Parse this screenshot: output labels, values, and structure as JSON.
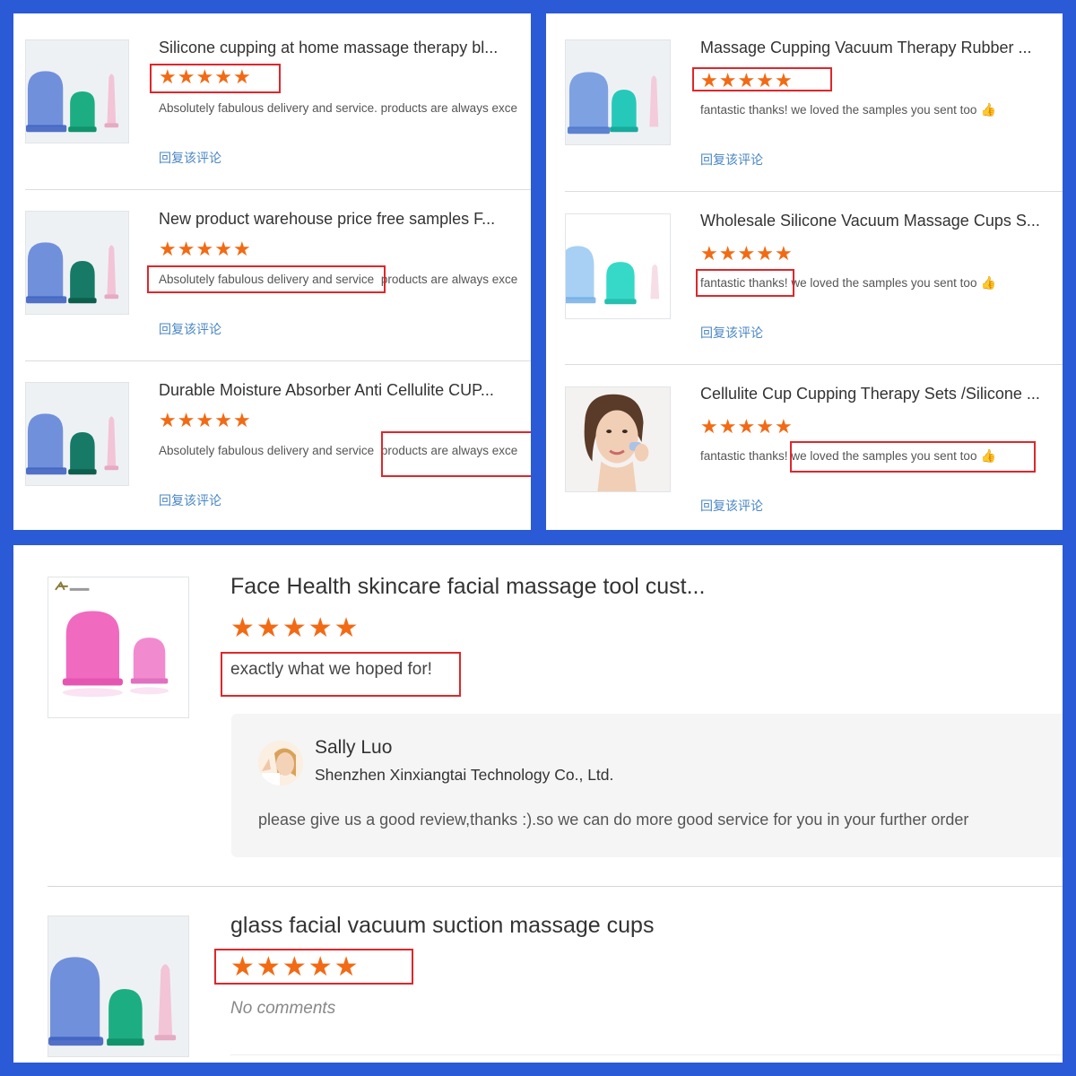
{
  "left_panel": {
    "reviews": [
      {
        "title": "Silicone cupping at home massage therapy bl...",
        "comment": "Absolutely fabulous delivery and service. products are always exce",
        "reply_link": "回复该评论"
      },
      {
        "title": "New product warehouse price free samples F...",
        "comment_part1": "Absolutely fabulous delivery and service",
        "comment_part2": "products are always exce",
        "reply_link": "回复该评论"
      },
      {
        "title": "Durable Moisture Absorber Anti Cellulite CUP...",
        "comment_part1": "Absolutely fabulous delivery and service",
        "comment_part2": "products are always exce",
        "reply_link": "回复该评论"
      }
    ]
  },
  "right_panel": {
    "reviews": [
      {
        "title": "Massage Cupping Vacuum Therapy Rubber ...",
        "comment": "fantastic thanks! we loved the samples you sent too",
        "reply_link": "回复该评论"
      },
      {
        "title": "Wholesale Silicone Vacuum Massage Cups S...",
        "comment_part1": "fantastic thanks!",
        "comment_part2": "we loved the samples you sent too",
        "reply_link": "回复该评论"
      },
      {
        "title": "Cellulite Cup Cupping Therapy Sets /Silicone ...",
        "comment_part1": "fantastic thanks!",
        "comment_part2": "we loved the samples you sent too",
        "reply_link": "回复该评论"
      }
    ]
  },
  "bottom_panel": {
    "review1": {
      "title": "Face Health skincare facial massage tool cust...",
      "comment": "exactly what we hoped for!",
      "reply": {
        "name": "Sally Luo",
        "company": "Shenzhen Xinxiangtai Technology Co., Ltd.",
        "text": "please give us a good review,thanks :).so we can do more good service for you in your further order"
      }
    },
    "review2": {
      "title": "glass facial vacuum suction massage cups",
      "comment": "No comments"
    }
  },
  "rating": {
    "stars": 5,
    "max": 5,
    "glyph": "★"
  },
  "colors": {
    "frame": "#2b5ad6",
    "star": "#f26a14",
    "highlight_box": "#e0262a",
    "link": "#4a86c5"
  },
  "icons": [
    "thumbs-up-icon",
    "star-icon"
  ]
}
